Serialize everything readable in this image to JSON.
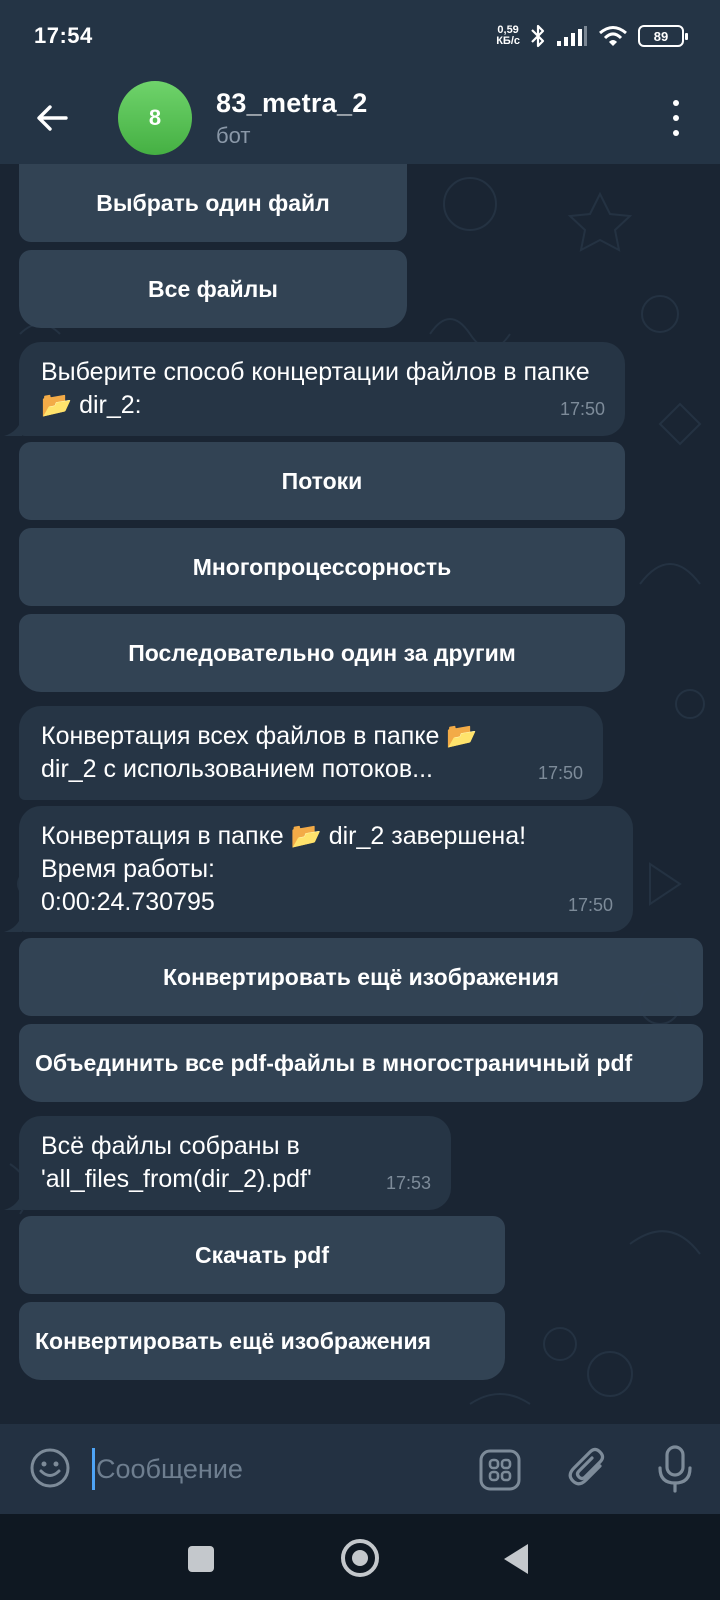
{
  "status_bar": {
    "time": "17:54",
    "net_speed_value": "0,59",
    "net_speed_unit": "КБ/с",
    "battery": "89",
    "icons": [
      "bluetooth-icon",
      "signal-icon",
      "wifi-icon",
      "battery-icon"
    ]
  },
  "header": {
    "avatar_text": "8",
    "avatar_color": "#4fbd4c",
    "title": "83_metra_2",
    "subtitle": "бот"
  },
  "chat": {
    "keyboard_1": {
      "buttons": [
        "Выбрать один файл",
        "Все файлы"
      ]
    },
    "message_1": {
      "text": "Выберите способ концертации файлов в папке 📂 dir_2:",
      "time": "17:50"
    },
    "keyboard_2": {
      "buttons": [
        "Потоки",
        "Многопроцессорность",
        "Последовательно один за другим"
      ]
    },
    "message_2": {
      "text": "Конвертация всех файлов в папке 📂 dir_2 с использованием потоков...",
      "time": "17:50"
    },
    "message_3": {
      "line1": "Конвертация в папке 📂 dir_2 завершена!",
      "line2": "Время работы:",
      "line3": "0:00:24.730795",
      "time": "17:50"
    },
    "keyboard_3": {
      "buttons": [
        "Конвертировать ещё изображения",
        "Объединить все pdf-файлы в многостраничный pdf"
      ]
    },
    "message_4": {
      "line1": "Всё файлы собраны в",
      "line2": "'all_files_from(dir_2).pdf'",
      "time": "17:53"
    },
    "keyboard_4": {
      "buttons": [
        "Скачать pdf",
        "Конвертировать ещё изображения"
      ]
    }
  },
  "input_bar": {
    "placeholder": "Сообщение",
    "value": ""
  },
  "colors": {
    "background": "#1a2533",
    "header": "#243445",
    "bubble": "#263545",
    "keyboard_button": "#344456",
    "accent": "#4ea4f6"
  }
}
